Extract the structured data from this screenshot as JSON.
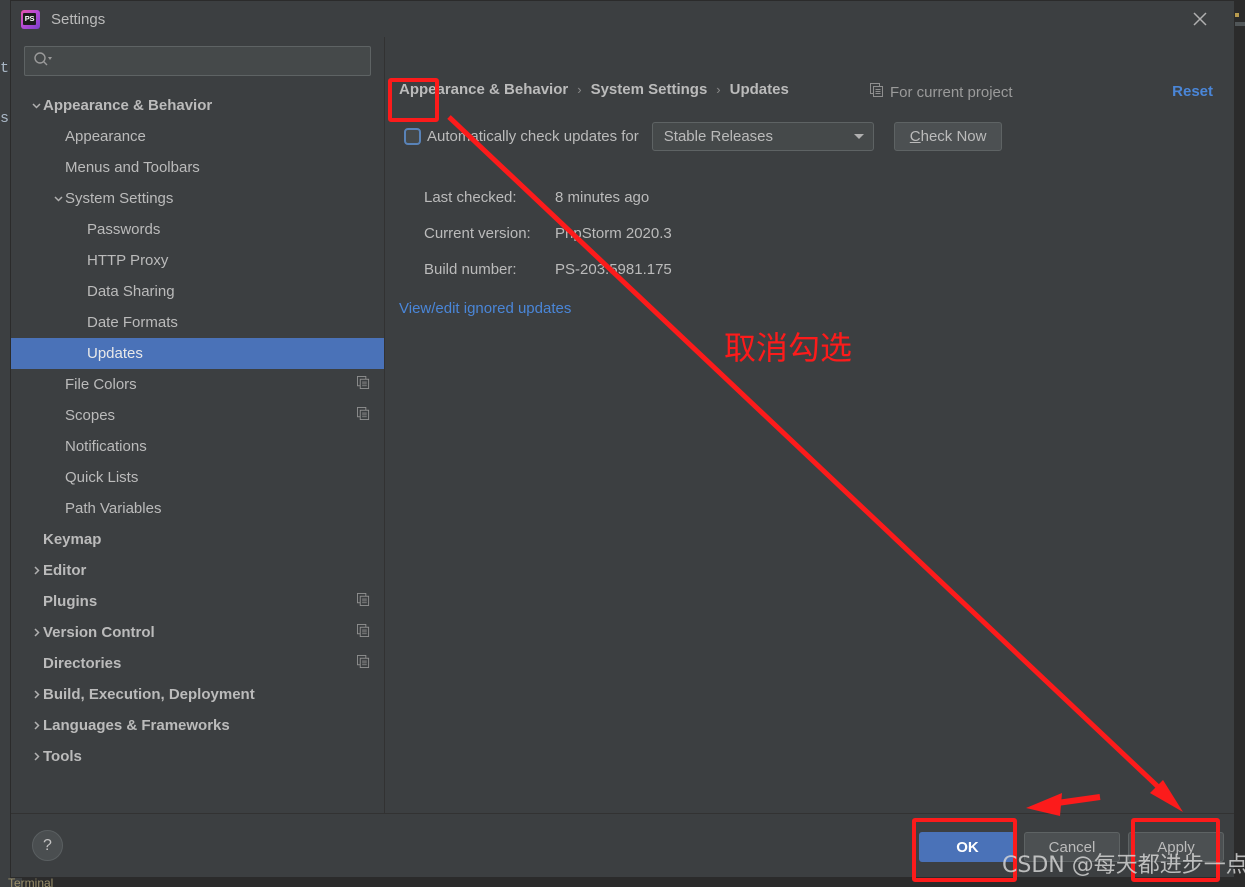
{
  "ide": {
    "ghost_left_top": "to",
    "ghost_left_bottom": "s",
    "bottom_tool_label": "Terminal"
  },
  "window": {
    "title": "Settings",
    "app_icon_text": "PS",
    "close_icon": "close-icon"
  },
  "search": {
    "value": "",
    "placeholder": "",
    "icon": "search-icon"
  },
  "sidebar": {
    "items": [
      {
        "label": "Appearance & Behavior",
        "indent": 0,
        "arrow": "down",
        "bold": true,
        "selected": false,
        "badge": false
      },
      {
        "label": "Appearance",
        "indent": 1,
        "arrow": "none",
        "bold": false,
        "selected": false,
        "badge": false
      },
      {
        "label": "Menus and Toolbars",
        "indent": 1,
        "arrow": "none",
        "bold": false,
        "selected": false,
        "badge": false
      },
      {
        "label": "System Settings",
        "indent": 1,
        "arrow": "down",
        "bold": false,
        "selected": false,
        "badge": false
      },
      {
        "label": "Passwords",
        "indent": 2,
        "arrow": "none",
        "bold": false,
        "selected": false,
        "badge": false
      },
      {
        "label": "HTTP Proxy",
        "indent": 2,
        "arrow": "none",
        "bold": false,
        "selected": false,
        "badge": false
      },
      {
        "label": "Data Sharing",
        "indent": 2,
        "arrow": "none",
        "bold": false,
        "selected": false,
        "badge": false
      },
      {
        "label": "Date Formats",
        "indent": 2,
        "arrow": "none",
        "bold": false,
        "selected": false,
        "badge": false
      },
      {
        "label": "Updates",
        "indent": 2,
        "arrow": "none",
        "bold": false,
        "selected": true,
        "badge": false
      },
      {
        "label": "File Colors",
        "indent": 1,
        "arrow": "none",
        "bold": false,
        "selected": false,
        "badge": true
      },
      {
        "label": "Scopes",
        "indent": 1,
        "arrow": "none",
        "bold": false,
        "selected": false,
        "badge": true
      },
      {
        "label": "Notifications",
        "indent": 1,
        "arrow": "none",
        "bold": false,
        "selected": false,
        "badge": false
      },
      {
        "label": "Quick Lists",
        "indent": 1,
        "arrow": "none",
        "bold": false,
        "selected": false,
        "badge": false
      },
      {
        "label": "Path Variables",
        "indent": 1,
        "arrow": "none",
        "bold": false,
        "selected": false,
        "badge": false
      },
      {
        "label": "Keymap",
        "indent": 0,
        "arrow": "none",
        "bold": true,
        "selected": false,
        "badge": false
      },
      {
        "label": "Editor",
        "indent": 0,
        "arrow": "right",
        "bold": true,
        "selected": false,
        "badge": false
      },
      {
        "label": "Plugins",
        "indent": 0,
        "arrow": "none",
        "bold": true,
        "selected": false,
        "badge": true
      },
      {
        "label": "Version Control",
        "indent": 0,
        "arrow": "right",
        "bold": true,
        "selected": false,
        "badge": true
      },
      {
        "label": "Directories",
        "indent": 0,
        "arrow": "none",
        "bold": true,
        "selected": false,
        "badge": true
      },
      {
        "label": "Build, Execution, Deployment",
        "indent": 0,
        "arrow": "right",
        "bold": true,
        "selected": false,
        "badge": false
      },
      {
        "label": "Languages & Frameworks",
        "indent": 0,
        "arrow": "right",
        "bold": true,
        "selected": false,
        "badge": false
      },
      {
        "label": "Tools",
        "indent": 0,
        "arrow": "right",
        "bold": true,
        "selected": false,
        "badge": false
      }
    ]
  },
  "breadcrumb": {
    "items": [
      "Appearance & Behavior",
      "System Settings",
      "Updates"
    ],
    "separator": "›"
  },
  "header": {
    "for_current_project": "For current project",
    "for_current_project_icon": "copy-scope-icon",
    "reset_label": "Reset",
    "reset_color": "#4a86d8"
  },
  "updates": {
    "auto_check_label": "Automatically check updates for",
    "auto_check_checked": false,
    "channel_selected": "Stable Releases",
    "channel_options": [
      "Stable Releases"
    ],
    "check_now_label": "Check Now",
    "check_now_mnemonic": "C",
    "info": [
      {
        "key": "Last checked:",
        "value": "8 minutes ago"
      },
      {
        "key": "Current version:",
        "value": "PhpStorm 2020.3"
      },
      {
        "key": "Build number:",
        "value": "PS-203.5981.175"
      }
    ],
    "ignored_updates_link": "View/edit ignored updates"
  },
  "footer": {
    "help_label": "?",
    "ok_label": "OK",
    "cancel_label": "Cancel",
    "apply_label": "Apply",
    "ok_accent_color": "#4a72b8"
  },
  "annotations": {
    "color": "#fc1b1b",
    "note_text": "取消勾选",
    "watermark": "CSDN @每天都进步一点点",
    "boxes": [
      "auto-check-checkbox",
      "ok-button",
      "apply-button"
    ],
    "arrows": [
      "checkbox-to-apply-diagonal",
      "apply-to-ok-horizontal"
    ]
  }
}
